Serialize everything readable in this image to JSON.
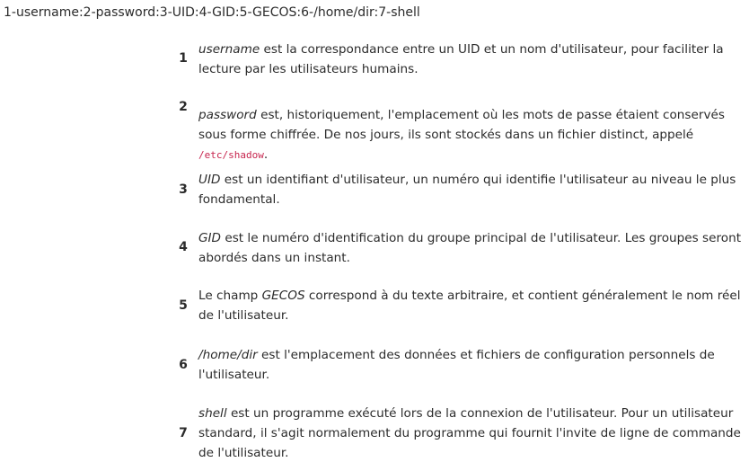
{
  "header": {
    "format_line": "1-username:2-password:3-UID:4-GID:5-GECOS:6-/home/dir:7-shell"
  },
  "items": [
    {
      "number": "1",
      "term": "username",
      "text": " est la correspondance entre un UID et un nom d'utilisateur, pour faciliter la lecture par les utilisateurs humains."
    },
    {
      "number": "2",
      "term": "password",
      "text": " est, historiquement, l'emplacement où les mots de passe étaient conservés sous forme chiffrée. De nos jours, ils sont stockés dans un fichier distinct, appelé ",
      "code": "/etc/shadow",
      "text_after": "."
    },
    {
      "number": "3",
      "term": "UID",
      "text": " est un identifiant d'utilisateur, un numéro qui identifie l'utilisateur au niveau le plus fondamental."
    },
    {
      "number": "4",
      "term": "GID",
      "text": " est le numéro d'identification du groupe principal de l'utilisateur. Les groupes seront abordés dans un instant."
    },
    {
      "number": "5",
      "text_before": "Le champ ",
      "term": "GECOS",
      "text": " correspond à du texte arbitraire, et contient généralement le nom réel de l'utilisateur."
    },
    {
      "number": "6",
      "term": "/home/dir",
      "text": " est l'emplacement des données et fichiers de configuration personnels de l'utilisateur."
    },
    {
      "number": "7",
      "term": "shell",
      "text": " est un programme exécuté lors de la connexion de l'utilisateur. Pour un utilisateur standard, il s'agit normalement du programme qui fournit l'invite de ligne de commande de l'utilisateur."
    }
  ]
}
